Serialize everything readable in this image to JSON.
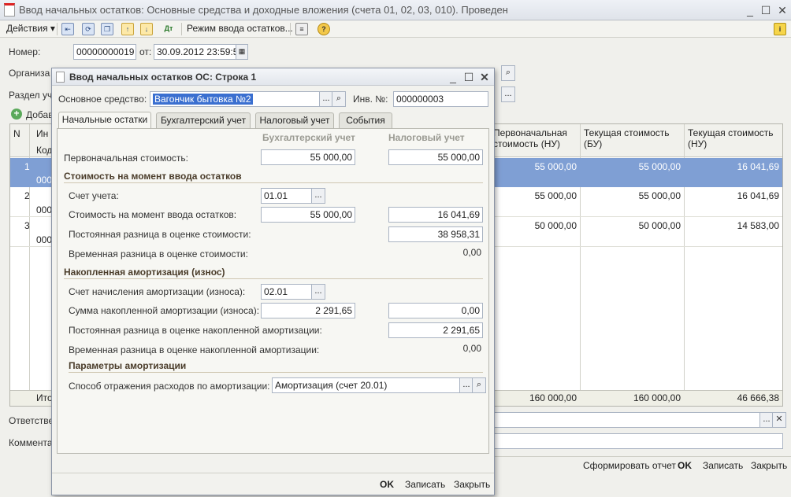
{
  "window": {
    "title": "Ввод начальных остатков: Основные средства и доходные вложения (счета 01, 02, 03, 010). Проведен",
    "minimize": "_",
    "maximize": "☐",
    "close": "✕"
  },
  "toolbar": {
    "actions": "Действия",
    "mode": "Режим ввода остатков...",
    "help": "?",
    "info": "i"
  },
  "form": {
    "number_label": "Номер:",
    "number_value": "00000000019",
    "from_label": "от:",
    "date_value": "30.09.2012 23:59:59",
    "org_label": "Организа",
    "section_label": "Раздел уч",
    "add_label": "Добав",
    "responsible_label": "Ответстве",
    "comment_label": "Коммента"
  },
  "table": {
    "headers": {
      "n": "N",
      "inv": "Ин",
      "code": "Код",
      "initial_nu": "Первоначальная стоимость (НУ)",
      "current_bu": "Текущая стоимость (БУ)",
      "current_nu": "Текущая стоимость (НУ)"
    },
    "rows": [
      {
        "n": "1",
        "sub": "000",
        "initial_nu": "55 000,00",
        "current_bu": "55 000,00",
        "current_nu": "16 041,69"
      },
      {
        "n": "2",
        "sub": "000",
        "initial_nu": "55 000,00",
        "current_bu": "55 000,00",
        "current_nu": "16 041,69"
      },
      {
        "n": "3",
        "sub": "000",
        "initial_nu": "50 000,00",
        "current_bu": "50 000,00",
        "current_nu": "14 583,00"
      }
    ],
    "totals": {
      "label": "Ито",
      "initial_nu": "160 000,00",
      "current_bu": "160 000,00",
      "current_nu": "46 666,38"
    }
  },
  "bottom_buttons": {
    "report": "Сформировать отчет",
    "ok": "OK",
    "save": "Записать",
    "close": "Закрыть"
  },
  "dialog": {
    "title": "Ввод начальных остатков ОС: Строка 1",
    "asset_label": "Основное средство:",
    "asset_value": "Вагончик бытовка №2",
    "inv_label": "Инв. №:",
    "inv_value": "000000003",
    "tabs": [
      "Начальные остатки",
      "Бухгалтерский учет",
      "Налоговый учет",
      "События"
    ],
    "col_bu": "Бухгалтерский учет",
    "col_nu": "Налоговый учет",
    "initial_cost_label": "Первоначальная стоимость:",
    "initial_cost_bu": "55 000,00",
    "initial_cost_nu": "55 000,00",
    "section_cost": "Стоимость на момент ввода остатков",
    "account_label": "Счет учета:",
    "account_value": "01.01",
    "cost_at_input_label": "Стоимость на момент ввода остатков:",
    "cost_at_input_bu": "55 000,00",
    "cost_at_input_nu": "16 041,69",
    "perm_diff_label": "Постоянная разница в оценке стоимости:",
    "perm_diff_nu": "38 958,31",
    "temp_diff_label": "Временная разница в оценке стоимости:",
    "temp_diff_nu": "0,00",
    "section_amort": "Накопленная амортизация (износ)",
    "amort_account_label": "Счет начисления амортизации (износа):",
    "amort_account_value": "02.01",
    "amort_sum_label": "Сумма накопленной амортизации (износа):",
    "amort_sum_bu": "2 291,65",
    "amort_sum_nu": "0,00",
    "amort_perm_label": "Постоянная разница в оценке накопленной амортизации:",
    "amort_perm_nu": "2 291,65",
    "amort_temp_label": "Временная разница в оценке накопленной амортизации:",
    "amort_temp_nu": "0,00",
    "section_params": "Параметры амортизации",
    "method_label": "Способ отражения расходов по амортизации:",
    "method_value": "Амортизация (счет 20.01)",
    "ok": "OK",
    "save": "Записать",
    "close": "Закрыть"
  }
}
